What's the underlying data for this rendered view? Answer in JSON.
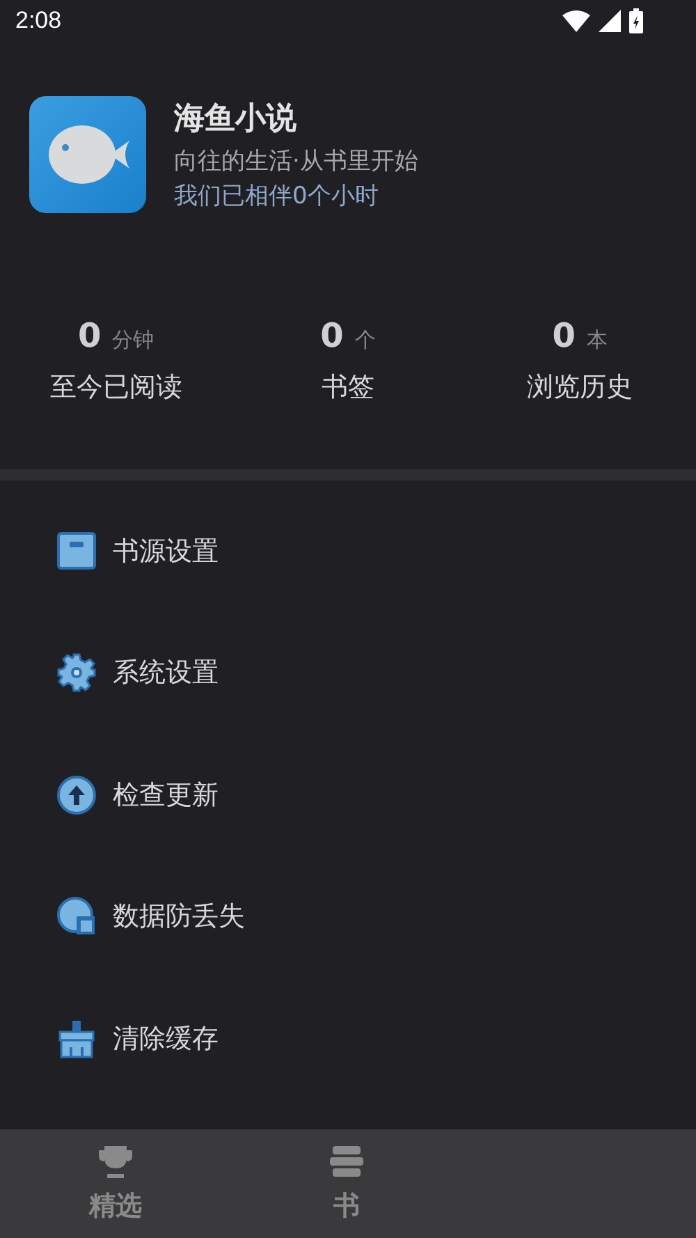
{
  "status_bar": {
    "time": "2:08"
  },
  "profile": {
    "name": "海鱼小说",
    "slogan": "向往的生活·从书里开始",
    "companion": "我们已相伴0个小时"
  },
  "stats": [
    {
      "value": "0",
      "unit": "分钟",
      "label": "至今已阅读"
    },
    {
      "value": "0",
      "unit": "个",
      "label": "书签"
    },
    {
      "value": "0",
      "unit": "本",
      "label": "浏览历史"
    }
  ],
  "menu": [
    {
      "kind": "source",
      "label": "书源设置"
    },
    {
      "kind": "settings",
      "label": "系统设置"
    },
    {
      "kind": "update",
      "label": "检查更新"
    },
    {
      "kind": "backup",
      "label": "数据防丢失"
    },
    {
      "kind": "clear",
      "label": "清除缓存"
    }
  ],
  "bottom_nav": [
    {
      "kind": "trophy",
      "label": "精选",
      "selected": false
    },
    {
      "kind": "books",
      "label": "书",
      "selected": false
    }
  ]
}
